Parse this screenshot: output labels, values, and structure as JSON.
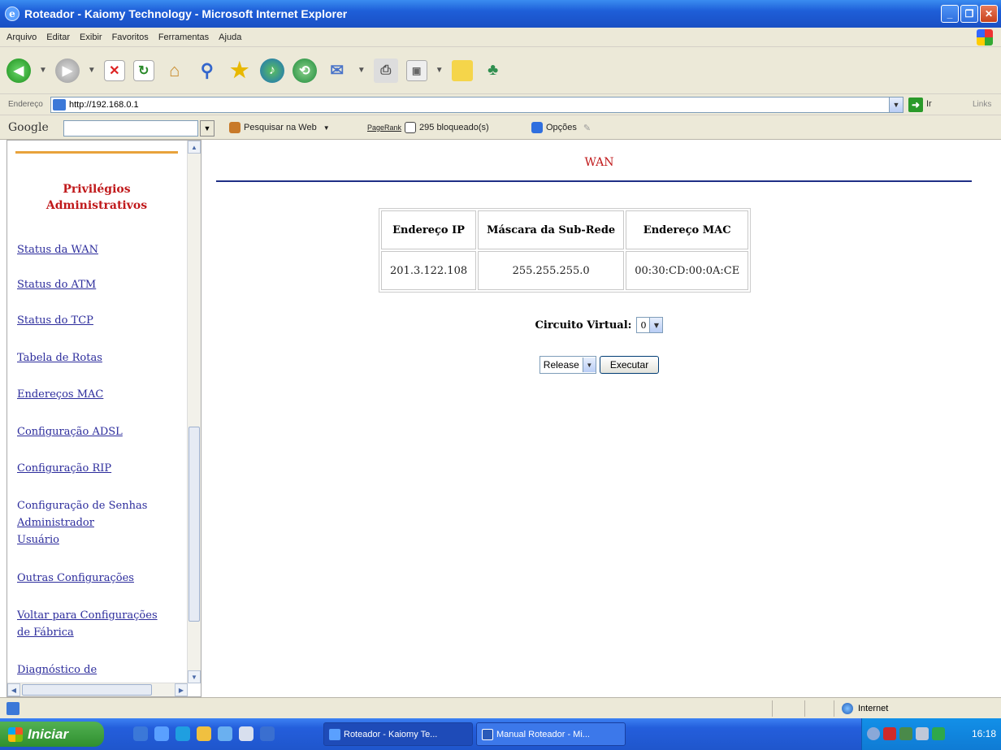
{
  "window": {
    "title": "Roteador - Kaiomy Technology - Microsoft Internet Explorer",
    "buttons": {
      "minimize": "_",
      "maximize": "❐",
      "close": "✕"
    }
  },
  "menu": [
    "Arquivo",
    "Editar",
    "Exibir",
    "Favoritos",
    "Ferramentas",
    "Ajuda"
  ],
  "address": {
    "label": "Endereço",
    "url": "http://192.168.0.1",
    "go_label": "Ir",
    "links_label": "Links"
  },
  "google_bar": {
    "logo": "Google",
    "search_web": "Pesquisar na Web",
    "pagerank": "PageRank",
    "blocked": "295 bloqueado(s)",
    "options": "Opções"
  },
  "sidebar": {
    "heading": "Privilégios Administrativos",
    "items": [
      {
        "label": "Status da WAN"
      },
      {
        "label": "Status do ATM"
      },
      {
        "label": "Status do TCP"
      },
      {
        "label": "Tabela de Rotas"
      },
      {
        "label": "Endereços MAC"
      },
      {
        "label": "Configuração ADSL"
      },
      {
        "label": "Configuração RIP"
      }
    ],
    "passwords": {
      "title": "Configuração de Senhas",
      "admin": "Administrador",
      "user": "Usuário"
    },
    "other": "Outras Configurações",
    "factory_line1": "Voltar para Configurações",
    "factory_line2": "de Fábrica",
    "diagnostic": "Diagnóstico de"
  },
  "main": {
    "title": "WAN",
    "table": {
      "headers": [
        "Endereço IP",
        "Máscara da Sub-Rede",
        "Endereço MAC"
      ],
      "row": [
        "201.3.122.108",
        "255.255.255.0",
        "00:30:CD:00:0A:CE"
      ]
    },
    "virtual_circuit": {
      "label": "Circuito Virtual:",
      "value": "0"
    },
    "action": {
      "value": "Release",
      "button": "Executar"
    }
  },
  "status": {
    "zone": "Internet"
  },
  "taskbar": {
    "start": "Iniciar",
    "tasks": [
      "Roteador - Kaiomy Te...",
      "Manual Roteador - Mi..."
    ],
    "clock": "16:18"
  },
  "colors": {
    "heading_red": "#c0191b",
    "link_blue": "#2c2c9c",
    "rule_navy": "#1f2f86",
    "rule_orange": "#e8a23c",
    "xp_blue": "#245edc"
  }
}
